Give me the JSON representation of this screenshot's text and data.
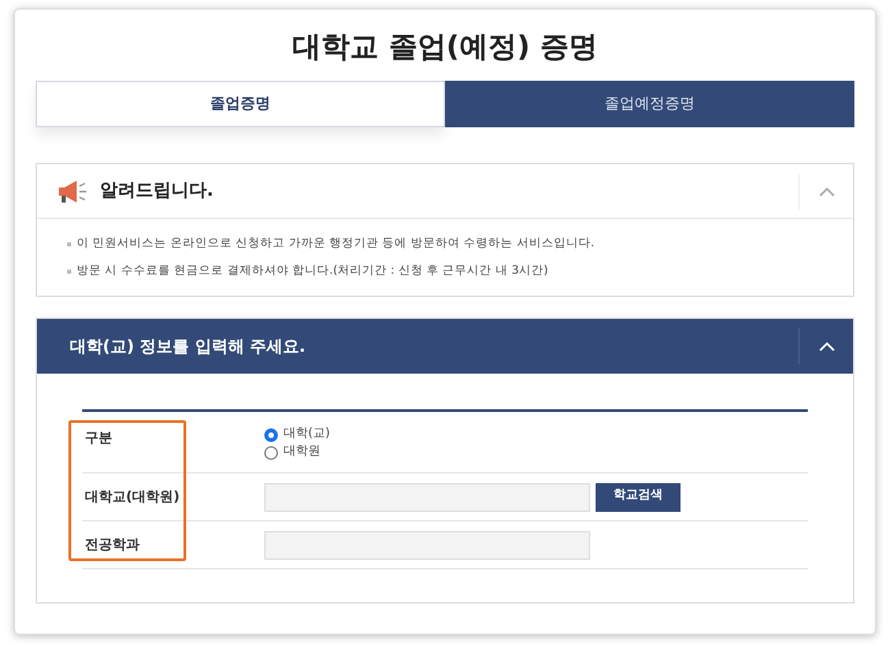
{
  "page_title": "대학교 졸업(예정) 증명",
  "tabs": [
    {
      "label": "졸업증명",
      "selected": true
    },
    {
      "label": "졸업예정증명",
      "selected": false
    }
  ],
  "notice": {
    "title": "알려드립니다.",
    "expanded": true,
    "items": [
      "이 민원서비스는 온라인으로 신청하고 가까운 행정기관 등에 방문하여 수령하는 서비스입니다.",
      "방문 시 수수료를 현금으로 결제하셔야 합니다.(처리기간 : 신청 후 근무시간 내 3시간)"
    ]
  },
  "form": {
    "title": "대학(교) 정보를 입력해 주세요.",
    "expanded": true,
    "labels_highlighted": true,
    "rows": [
      {
        "kind": "radio",
        "label": "구분",
        "options": [
          {
            "label": "대학(교)",
            "selected": true
          },
          {
            "label": "대학원",
            "selected": false
          }
        ]
      },
      {
        "kind": "search",
        "label": "대학교(대학원)",
        "button": "학교검색"
      },
      {
        "kind": "text",
        "label": "전공학과"
      }
    ]
  }
}
